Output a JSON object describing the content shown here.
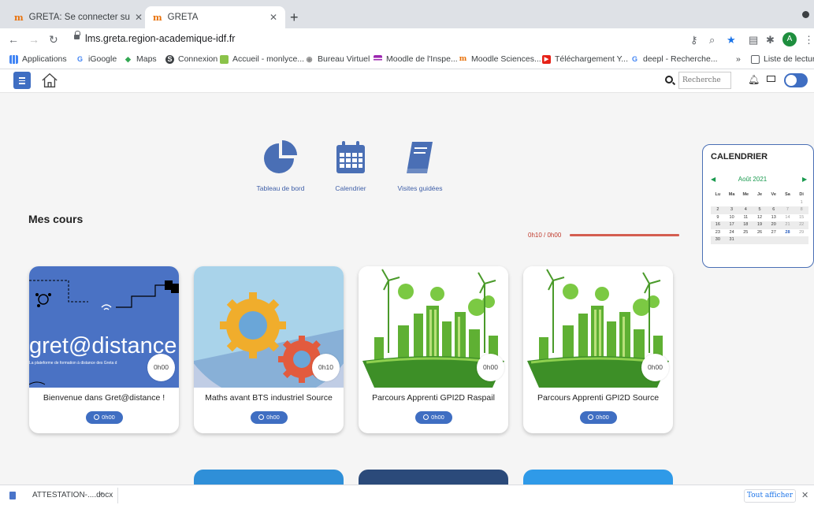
{
  "browser": {
    "tabs": [
      {
        "title": "GRETA: Se connecter sur le site",
        "favicon": "m"
      },
      {
        "title": "GRETA",
        "favicon": "m"
      }
    ],
    "url": "lms.greta.region-academique-idf.fr",
    "avatar_letter": "A",
    "bookmarks": [
      {
        "label": "Applications",
        "icon": "apps-grid-icon"
      },
      {
        "label": "iGoogle",
        "icon": "google-icon"
      },
      {
        "label": "Maps",
        "icon": "maps-icon"
      },
      {
        "label": "Connexion",
        "icon": "connexion-icon"
      },
      {
        "label": "Accueil - monlyce...",
        "icon": "monlycee-icon"
      },
      {
        "label": "Bureau Virtuel",
        "icon": "bureau-icon"
      },
      {
        "label": "Moodle de l'Inspe...",
        "icon": "moodle-icon"
      },
      {
        "label": "Moodle Sciences...",
        "icon": "moodle-sciences-icon"
      },
      {
        "label": "Téléchargement Y...",
        "icon": "youtube-icon"
      },
      {
        "label": "deepl - Recherche...",
        "icon": "google-icon"
      },
      {
        "label": "»",
        "icon": ""
      },
      {
        "label": "Liste de lecture",
        "icon": "reading-list-icon"
      }
    ]
  },
  "header": {
    "search_placeholder": "Recherche"
  },
  "quicklinks": [
    {
      "label": "Tableau de bord",
      "icon": "pie-chart-icon"
    },
    {
      "label": "Calendrier",
      "icon": "calendar-icon"
    },
    {
      "label": "Visites guidées",
      "icon": "book-icon"
    }
  ],
  "section_title": "Mes cours",
  "progress": {
    "label": "0h10 / 0h00",
    "fraction": 1.0
  },
  "calendar": {
    "title": "CALENDRIER",
    "month": "Août 2021",
    "weekdays": [
      "Lu",
      "Ma",
      "Me",
      "Je",
      "Ve",
      "Sa",
      "Di"
    ],
    "weeks": [
      [
        "",
        "",
        "",
        "",
        "",
        "",
        "1"
      ],
      [
        "2",
        "3",
        "4",
        "5",
        "6",
        "7",
        "8"
      ],
      [
        "9",
        "10",
        "11",
        "12",
        "13",
        "14",
        "15"
      ],
      [
        "16",
        "17",
        "18",
        "19",
        "20",
        "21",
        "22"
      ],
      [
        "23",
        "24",
        "25",
        "26",
        "27",
        "28",
        "29"
      ],
      [
        "30",
        "31",
        "",
        "",
        "",
        "",
        ""
      ]
    ],
    "highlight_day": "28"
  },
  "courses": [
    {
      "title": "Bienvenue dans Gret@distance !",
      "time_circle": "0h00",
      "badge": "0h00",
      "image_text": "gret@distance",
      "image_subtext": "La plateforme de formation à distance des Greta d"
    },
    {
      "title": "Maths avant BTS industriel Source",
      "time_circle": "0h10",
      "badge": "0h00"
    },
    {
      "title": "Parcours Apprenti GPI2D Raspail",
      "time_circle": "0h00",
      "badge": "0h00"
    },
    {
      "title": "Parcours Apprenti GPI2D Source",
      "time_circle": "0h00",
      "badge": "0h00"
    }
  ],
  "downloads": {
    "file_name": "ATTESTATION-....docx",
    "show_all": "Tout afficher"
  },
  "colors": {
    "primary": "#3f6ec2",
    "accent_green": "#1a9a4f",
    "progress_red": "#d45e50"
  }
}
